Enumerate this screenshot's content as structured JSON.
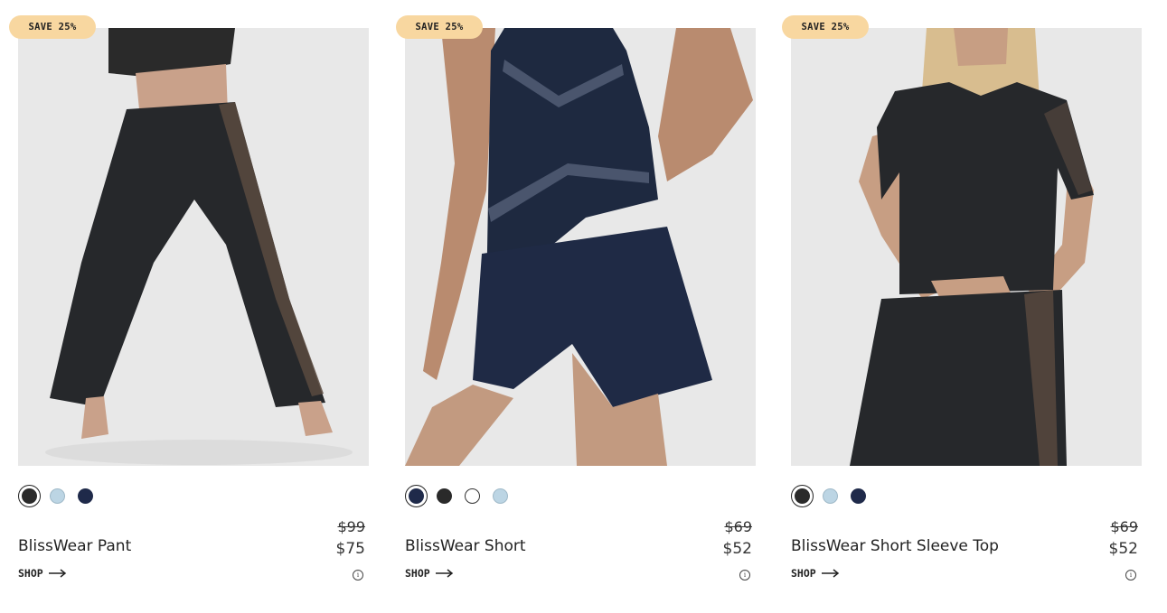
{
  "products": [
    {
      "badge": "SAVE 25%",
      "name": "BlissWear Pant",
      "price_old": "$99",
      "price_new": "$75",
      "shop_label": "SHOP",
      "swatches": [
        "#2a2a2a",
        "#bcd5e4",
        "#1f2a4a"
      ],
      "selected_swatch": 0,
      "image_subject": "model wearing black wide-leg pants with mesh side stripe"
    },
    {
      "badge": "SAVE 25%",
      "name": "BlissWear Short",
      "price_old": "$69",
      "price_new": "$52",
      "shop_label": "SHOP",
      "swatches": [
        "#1f2a4a",
        "#2a2a2a",
        "#ffffff",
        "#bcd5e4"
      ],
      "selected_swatch": 0,
      "image_subject": "model wearing navy camisole and navy shorts"
    },
    {
      "badge": "SAVE 25%",
      "name": "BlissWear Short Sleeve Top",
      "price_old": "$69",
      "price_new": "$52",
      "shop_label": "SHOP",
      "swatches": [
        "#2a2a2a",
        "#bcd5e4",
        "#1f2a4a"
      ],
      "selected_swatch": 0,
      "image_subject": "model wearing black short sleeve top and black pants"
    }
  ],
  "colors": {
    "badge_bg": "#f8d7a0",
    "image_bg": "#e6e6e6",
    "text": "#222222"
  },
  "icons": {
    "shop_arrow": "arrow-right-icon",
    "info": "info-icon"
  }
}
